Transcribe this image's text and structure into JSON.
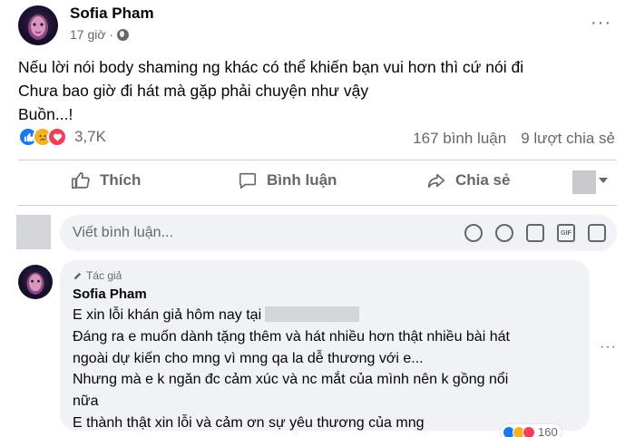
{
  "post": {
    "author": "Sofia Pham",
    "time": "17 giờ ·",
    "more_icon": "···",
    "text_lines": [
      "Nếu lời nói body shaming ng khác có thể khiến bạn vui hơn thì cứ nói đi",
      "Chưa bao giờ đi hát mà gặp phải chuyện như vậy",
      "Buồn...!"
    ],
    "reactions": {
      "icons": [
        "like-icon",
        "sad-icon",
        "love-icon"
      ],
      "count": "3,7K"
    },
    "stats": {
      "comments": "167 bình luận",
      "shares": "9 lượt chia sẻ"
    },
    "actions": {
      "like": "Thích",
      "comment": "Bình luận",
      "share": "Chia sẻ"
    }
  },
  "composer": {
    "placeholder": "Viết bình luận..."
  },
  "comment": {
    "badge": "Tác giả",
    "author": "Sofia Pham",
    "lines": [
      "E xin lỗi khán giả hôm nay tại",
      "Đáng ra e muốn dành tặng thêm và hát nhiều hơn thật nhiều bài hát",
      "ngoài dự kiến cho mng vì mng qa la dễ thương với e...",
      "Nhưng mà e k ngăn đc cảm xúc và nc mắt của mình nên k gồng nổi",
      "nữa",
      "E thành thật xin lỗi và cảm ơn sự yêu thương của mng"
    ],
    "more_icon": "···",
    "reaction_count": "160"
  },
  "colors": {
    "like": "#1877f2",
    "sad": "#f7b125",
    "love": "#f33e58",
    "muted": "#65676b",
    "bubble": "#f0f2f5"
  }
}
